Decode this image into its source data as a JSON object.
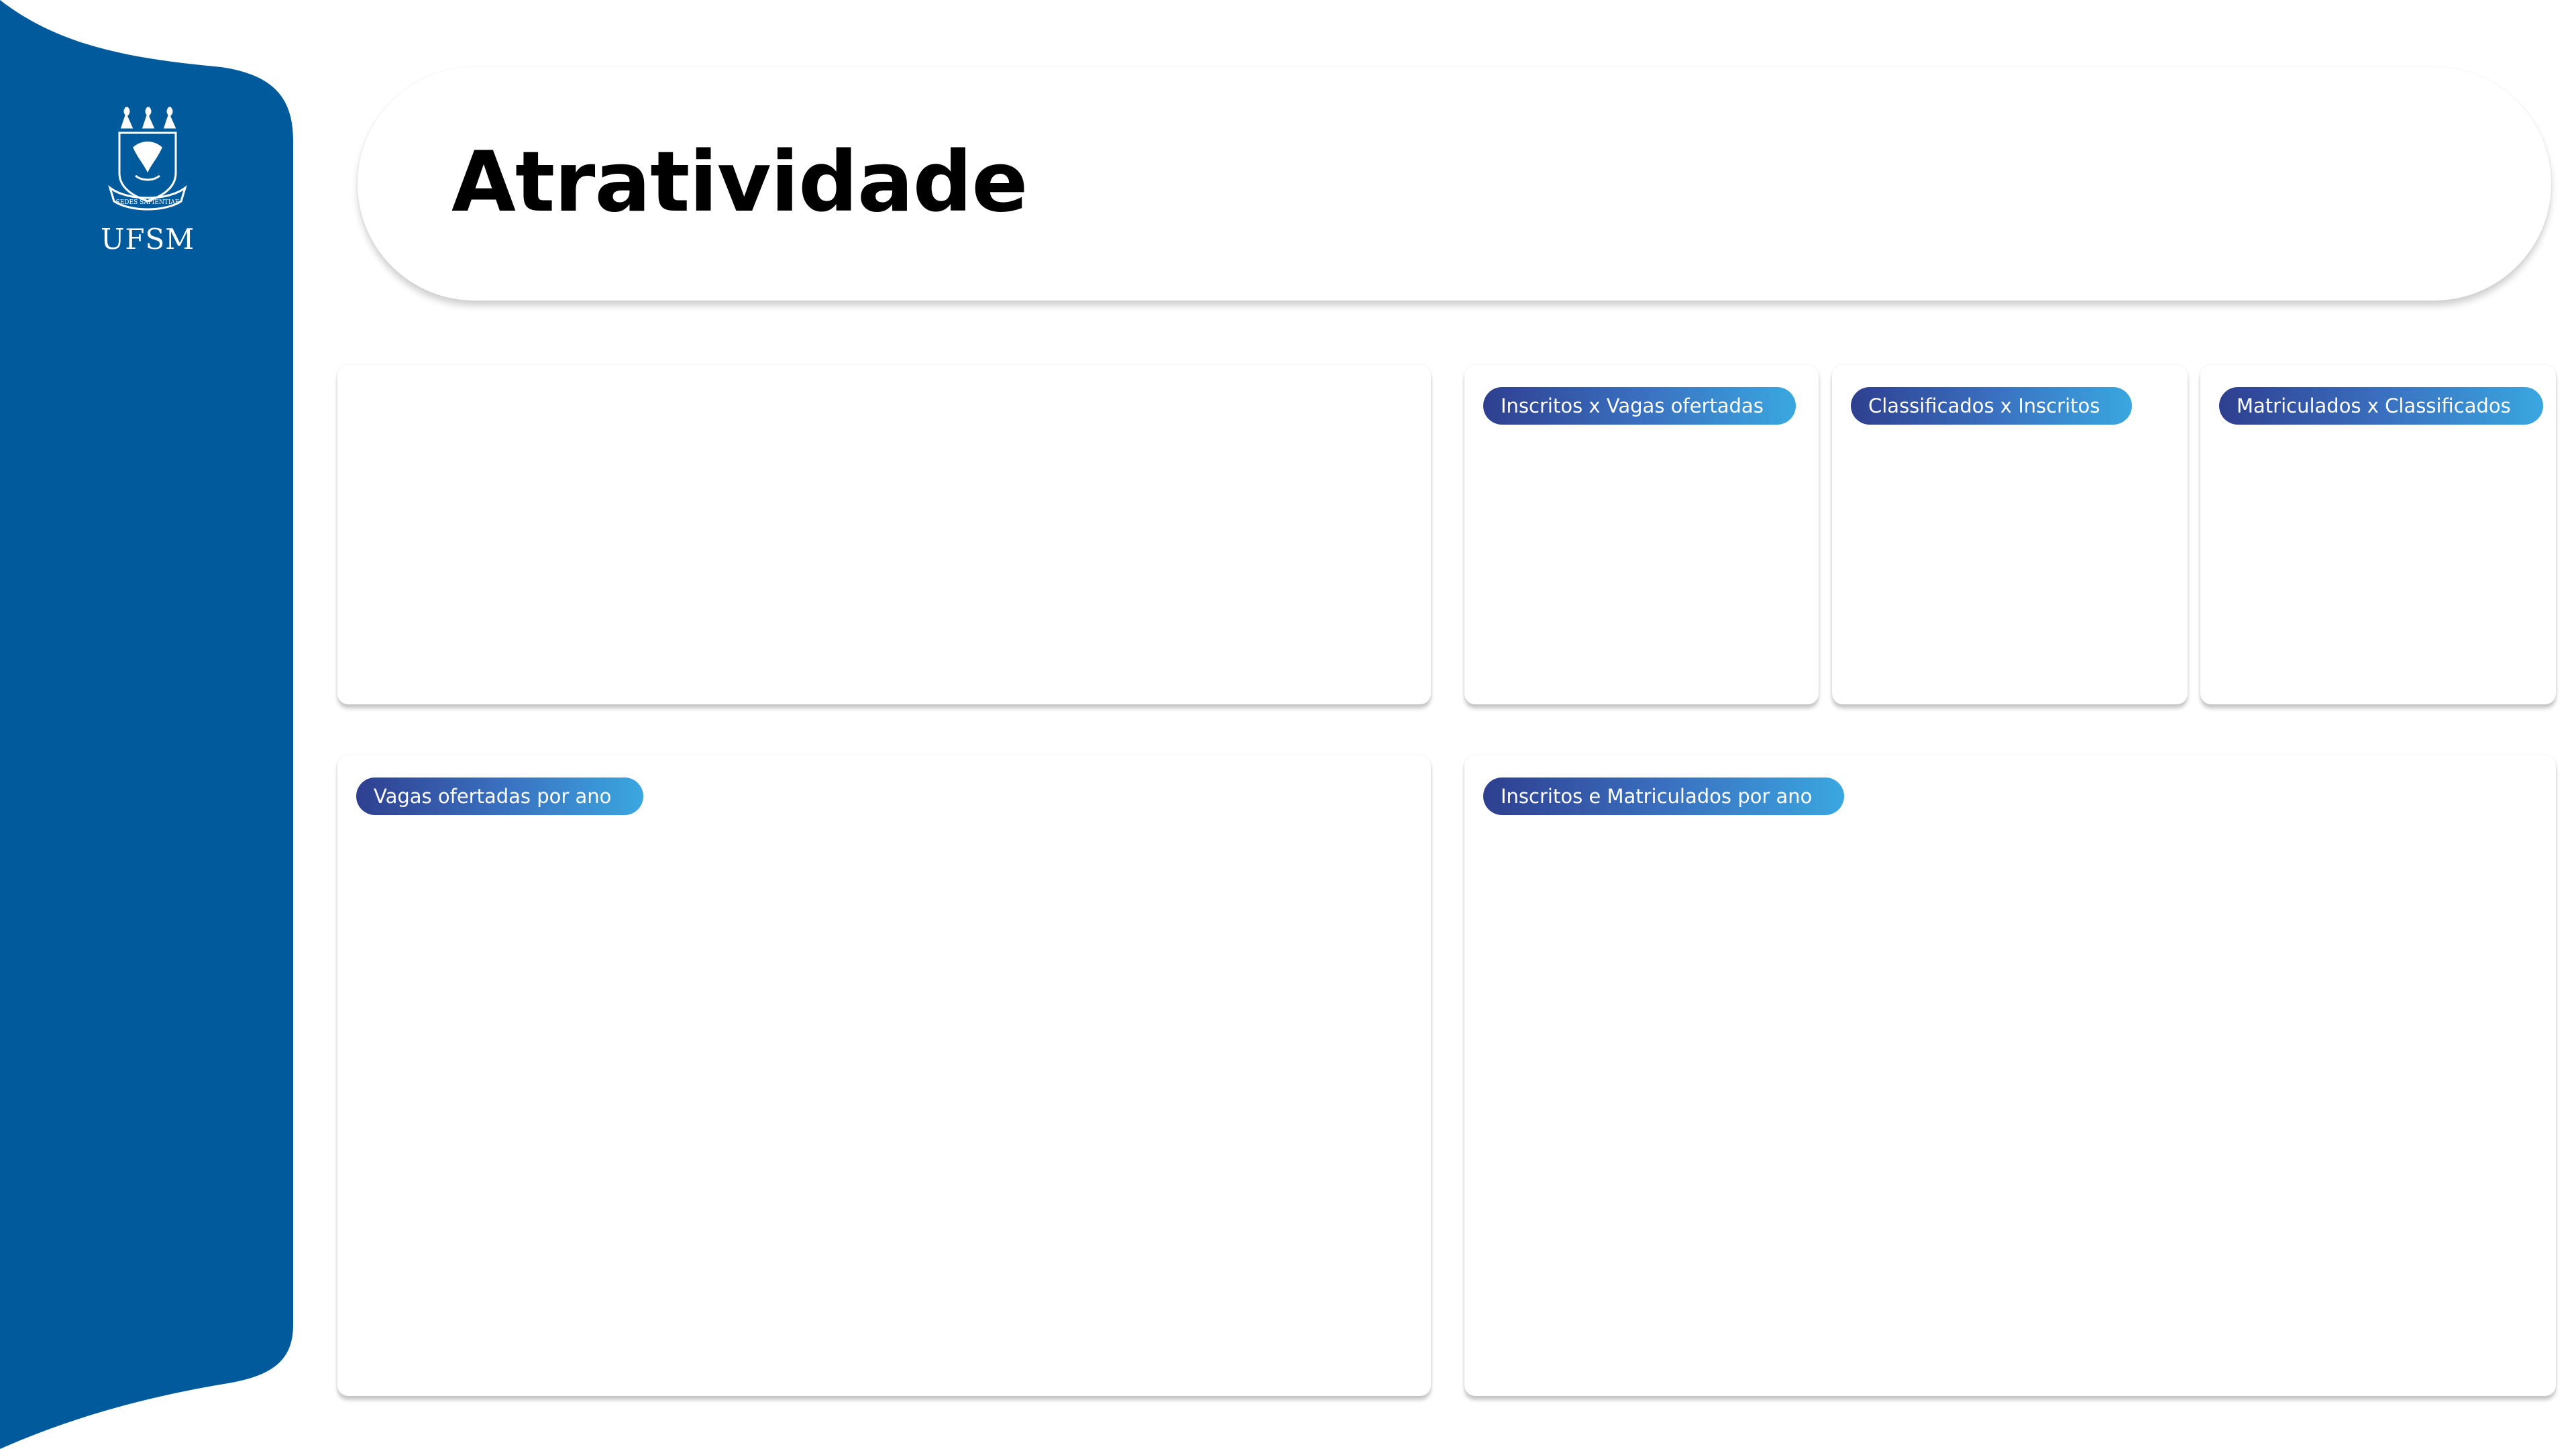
{
  "sidebar": {
    "logo_text": "UFSM",
    "logo_motto": "SEDES SAPIENTIAE",
    "color": "#005a9c"
  },
  "header": {
    "title": "Atratividade"
  },
  "cards": {
    "main_top": {
      "label": ""
    },
    "ratio_inscritos_vagas": {
      "label": "Inscritos x Vagas ofertadas"
    },
    "ratio_classificados_inscritos": {
      "label": "Classificados x Inscritos"
    },
    "ratio_matriculados_classificados": {
      "label": "Matriculados x Classificados"
    },
    "vagas_por_ano": {
      "label": "Vagas ofertadas por ano"
    },
    "inscritos_matriculados_por_ano": {
      "label": "Inscritos e Matriculados por ano"
    }
  },
  "colors": {
    "chip_start": "#2f3f8f",
    "chip_end": "#3aa7e0",
    "background": "#ffffff"
  }
}
